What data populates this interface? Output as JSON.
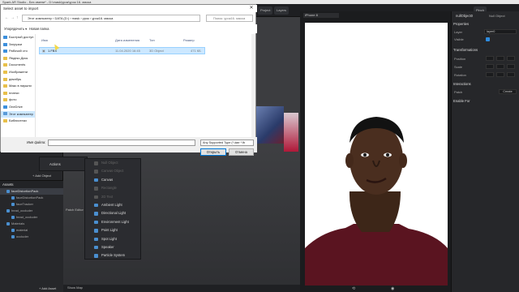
{
  "window": {
    "title": "Spark AR Studio - Без имени* - D:\\mask\\урок\\урок 16. маска"
  },
  "toolbar": {
    "project_label": "Project",
    "layers_label": "Layers",
    "pinch_label": "Pinch"
  },
  "scene_panel": {
    "title": "Scene",
    "assets_title": "Assets",
    "add_object": "+ Add Object",
    "add_asset": "+ Add Asset",
    "assets": [
      "faceDistortionPack",
      "faceDistortionPack",
      "faceTracker",
      "head_occluder",
      "head_occluder",
      "Materials",
      "material",
      "occluder"
    ]
  },
  "viewport": {
    "actions_label": "Actions",
    "patch_label": "Patch Editor",
    "show_map": "Show Map"
  },
  "context_menu": {
    "items": [
      {
        "label": "Null Object",
        "enabled": false
      },
      {
        "label": "Canvas Object",
        "enabled": false
      },
      {
        "label": "Canvas",
        "enabled": true
      },
      {
        "label": "Rectangle",
        "enabled": false
      },
      {
        "label": "2D Text",
        "enabled": false
      },
      {
        "label": "Ambient Light",
        "enabled": true
      },
      {
        "label": "Directional Light",
        "enabled": true
      },
      {
        "label": "Environment Light",
        "enabled": true
      },
      {
        "label": "Point Light",
        "enabled": true
      },
      {
        "label": "Spot Light",
        "enabled": true
      },
      {
        "label": "Speaker",
        "enabled": true
      },
      {
        "label": "Particle System",
        "enabled": true
      }
    ]
  },
  "preview": {
    "device": "iPhone 8"
  },
  "inspector": {
    "object_name": "nullObject0",
    "object_type": "Null Object",
    "properties_label": "Properties",
    "layer_label": "Layer",
    "layer_value": "layer0",
    "visible_label": "Visible",
    "transformations_label": "Transformations",
    "position_label": "Position",
    "scale_label": "Scale",
    "rotation_label": "Rotation",
    "interactions_label": "Interactions",
    "patch_label": "Patch",
    "create_label": "Create",
    "enable_for_label": "Enable For"
  },
  "dialog": {
    "title": "Select asset to import",
    "address": "Этот компьютер › DATA (D:) › mask › урок › урок16. маска",
    "search_placeholder": "Поиск: урок16. маска",
    "organize": "Упорядочить ▾",
    "new_folder": "Новая папка",
    "nav_items": [
      {
        "label": "Быстрый доступ",
        "icon": "star-icon"
      },
      {
        "label": "Загрузки",
        "icon": "download-icon"
      },
      {
        "label": "Рабочий сто",
        "icon": "folder-icon"
      },
      {
        "label": "Яндекс.Диск",
        "icon": "folder-icon"
      },
      {
        "label": "Documents",
        "icon": "folder-icon"
      },
      {
        "label": "Изображени",
        "icon": "folder-icon"
      },
      {
        "label": "декабрь",
        "icon": "folder-icon"
      },
      {
        "label": "Макс в наушни",
        "icon": "folder-icon"
      },
      {
        "label": "платки",
        "icon": "folder-icon"
      },
      {
        "label": "фото",
        "icon": "folder-icon"
      },
      {
        "label": "OneDrive",
        "icon": "cloud-icon"
      },
      {
        "label": "Этот компьютер",
        "icon": "pc-icon"
      },
      {
        "label": "Библиотеки",
        "icon": "library-icon"
      }
    ],
    "columns": {
      "name": "Имя",
      "date": "Дата изменения",
      "type": "Тип",
      "size": "Размер"
    },
    "files": [
      {
        "name": "1.FBX",
        "date": "11.04.2020 16:45",
        "type": "3D Object",
        "size": "471 КБ"
      }
    ],
    "filename_label": "Имя файла:",
    "filename_value": "",
    "type_filter": "Any Supported Type (*.dae *.fb",
    "open_button": "Открыть",
    "cancel_button": "Отмена"
  }
}
